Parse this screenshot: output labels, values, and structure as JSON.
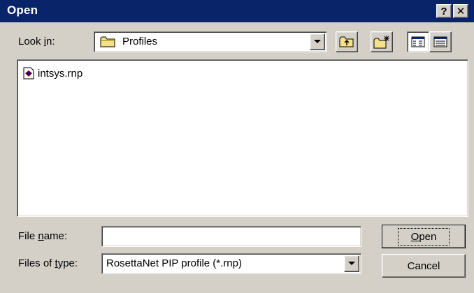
{
  "window": {
    "title": "Open",
    "help_label": "?",
    "close_label": "✕"
  },
  "lookin": {
    "label_pre": "Look ",
    "label_key": "i",
    "label_post": "n:",
    "value": "Profiles",
    "icon": "folder-icon"
  },
  "toolbar": {
    "up_icon": "up-folder-icon",
    "new_icon": "new-folder-icon",
    "list_icon": "list-view-icon",
    "details_icon": "details-view-icon"
  },
  "files": [
    {
      "name": "intsys.rnp",
      "icon": "file-icon"
    }
  ],
  "filename": {
    "label_pre": "File ",
    "label_key": "n",
    "label_post": "ame:",
    "value": ""
  },
  "filetype": {
    "label_pre": "Files of ",
    "label_key": "t",
    "label_post": "ype:",
    "value": "RosettaNet PIP profile (*.rnp)"
  },
  "buttons": {
    "open_key": "O",
    "open_rest": "pen",
    "cancel": "Cancel"
  },
  "colors": {
    "titlebar": "#0a246a",
    "face": "#d4d0c8"
  }
}
